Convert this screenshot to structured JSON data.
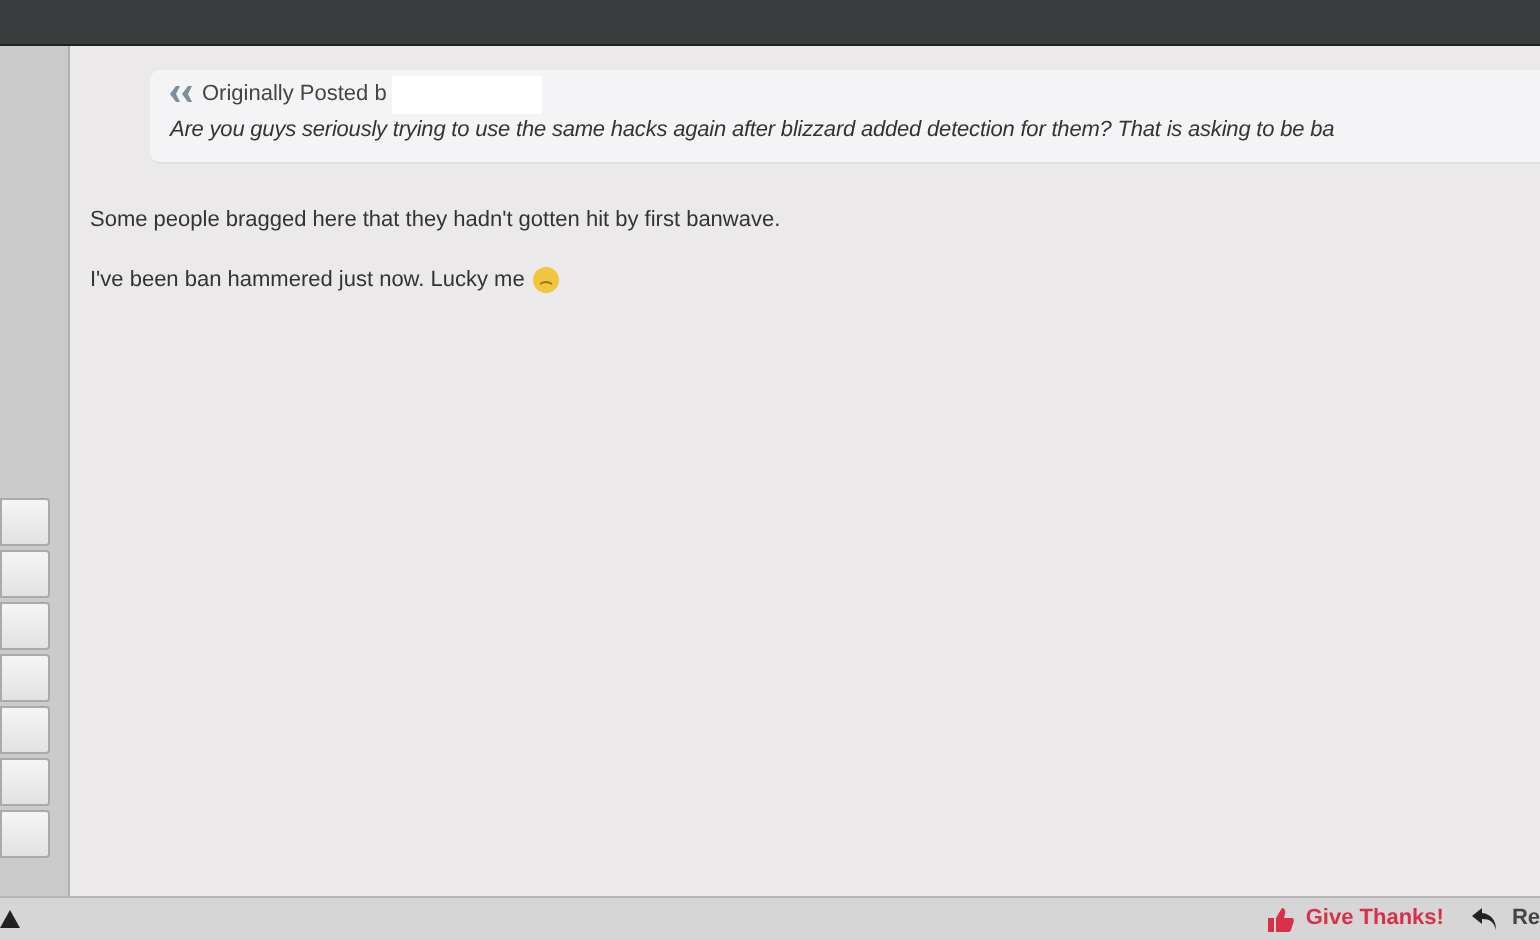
{
  "quote": {
    "label": "Originally Posted b",
    "text": "Are you guys seriously trying to use the same hacks again after blizzard added detection for them? That is asking to be ba"
  },
  "post": {
    "paragraphs": [
      "Some people bragged here that they hadn't gotten hit by first banwave.",
      "I've been ban hammered just now. Lucky me"
    ]
  },
  "sidebar": {
    "button_count_items": [
      {
        "kind": "button"
      },
      {
        "kind": "button"
      },
      {
        "kind": "button"
      },
      {
        "kind": "button"
      },
      {
        "kind": "button"
      },
      {
        "kind": "button"
      },
      {
        "kind": "button"
      }
    ]
  },
  "footer": {
    "actions": [
      {
        "kind": "thanks",
        "label": "Give Thanks!"
      },
      {
        "kind": "reply",
        "label": "Re"
      }
    ]
  }
}
